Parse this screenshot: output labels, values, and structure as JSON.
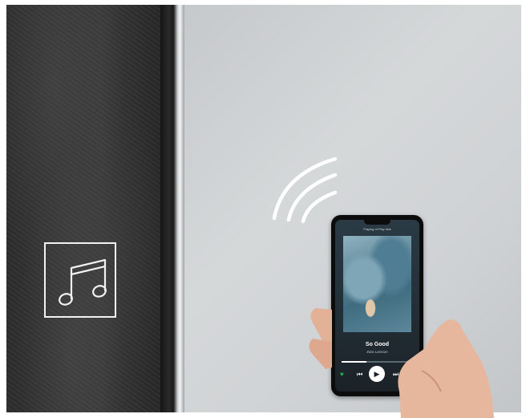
{
  "phone_screen": {
    "playing_from": "Playing of Play lists",
    "song_title": "So Good",
    "artist": "Zara Larsson",
    "progress": 0.35,
    "controls": [
      "heart-icon",
      "previous-icon",
      "play-icon",
      "next-icon",
      "devices-icon"
    ]
  },
  "icons": {
    "music": "music-note-icon",
    "wireless": "wireless-signal-icon"
  },
  "colors": {
    "stone": "#333333",
    "mirror": "#cfd2d4",
    "frame_highlight": "#f3f4f4",
    "icon_line": "#f2f2f2",
    "heart_accent": "#1db954"
  }
}
